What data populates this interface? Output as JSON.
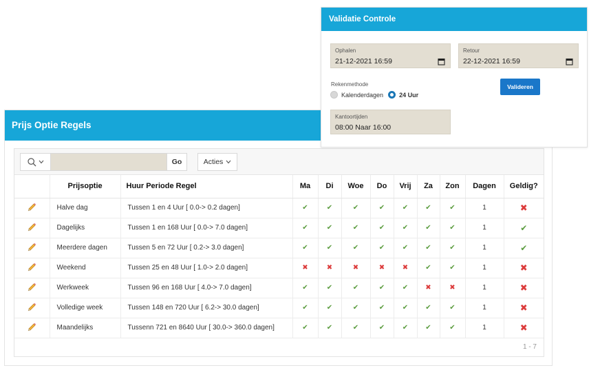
{
  "prijs_panel": {
    "title": "Prijs Optie Regels",
    "toolbar": {
      "search_value": "",
      "go_label": "Go",
      "acties_label": "Acties"
    },
    "columns": [
      "",
      "Prijsoptie",
      "Huur Periode Regel",
      "Ma",
      "Di",
      "Woe",
      "Do",
      "Vrij",
      "Za",
      "Zon",
      "Dagen",
      "Geldig?"
    ],
    "rows": [
      {
        "prijsoptie": "Halve dag",
        "regel": "Tussen 1 en 4 Uur [ 0.0-> 0.2 dagen]",
        "days": [
          true,
          true,
          true,
          true,
          true,
          true,
          true
        ],
        "dagen": "1",
        "geldig": false
      },
      {
        "prijsoptie": "Dagelijks",
        "regel": "Tussen 1 en 168 Uur [ 0.0-> 7.0 dagen]",
        "days": [
          true,
          true,
          true,
          true,
          true,
          true,
          true
        ],
        "dagen": "1",
        "geldig": true
      },
      {
        "prijsoptie": "Meerdere dagen",
        "regel": "Tussen 5 en 72 Uur [ 0.2-> 3.0 dagen]",
        "days": [
          true,
          true,
          true,
          true,
          true,
          true,
          true
        ],
        "dagen": "1",
        "geldig": true
      },
      {
        "prijsoptie": "Weekend",
        "regel": "Tussen 25 en 48 Uur [ 1.0-> 2.0 dagen]",
        "days": [
          false,
          false,
          false,
          false,
          false,
          true,
          true
        ],
        "dagen": "1",
        "geldig": false
      },
      {
        "prijsoptie": "Werkweek",
        "regel": "Tussen 96 en 168 Uur [ 4.0-> 7.0 dagen]",
        "days": [
          true,
          true,
          true,
          true,
          true,
          false,
          false
        ],
        "dagen": "1",
        "geldig": false
      },
      {
        "prijsoptie": "Volledige week",
        "regel": "Tussen 148 en 720 Uur [ 6.2-> 30.0 dagen]",
        "days": [
          true,
          true,
          true,
          true,
          true,
          true,
          true
        ],
        "dagen": "1",
        "geldig": false
      },
      {
        "prijsoptie": "Maandelijks",
        "regel": "Tussenn 721 en 8640 Uur [ 30.0-> 360.0 dagen]",
        "days": [
          true,
          true,
          true,
          true,
          true,
          true,
          true
        ],
        "dagen": "1",
        "geldig": false
      }
    ],
    "pagination": "1 - 7"
  },
  "validatie_panel": {
    "title": "Validatie Controle",
    "ophalen": {
      "label": "Ophalen",
      "value": "21-12-2021 16:59"
    },
    "retour": {
      "label": "Retour",
      "value": "22-12-2021 16:59"
    },
    "rekenmethode": {
      "label": "Rekenmethode",
      "options": [
        "Kalenderdagen",
        "24 Uur"
      ],
      "selected": "24 Uur"
    },
    "valideren_label": "Valideren",
    "kantoortijden": {
      "label": "Kantoortijden",
      "value": "08:00 Naar 16:00"
    }
  },
  "colors": {
    "header_blue": "#17a6d8",
    "button_blue": "#1a77c9",
    "field_bg": "#e3ded2",
    "check_green": "#5b9c3f",
    "cross_red": "#dc3b3b"
  }
}
